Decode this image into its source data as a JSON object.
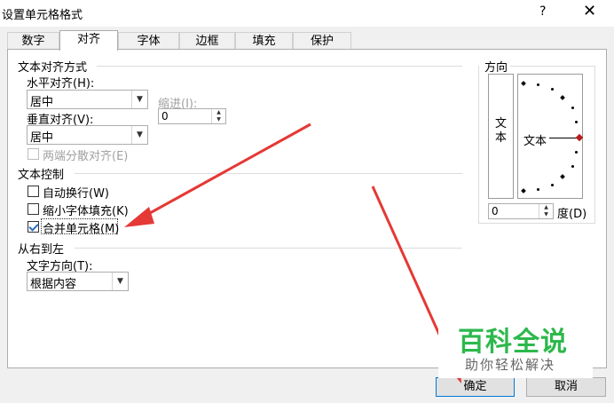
{
  "window": {
    "title": "设置单元格格式",
    "help": "?",
    "close": "✕"
  },
  "tabs": [
    {
      "label": "数字"
    },
    {
      "label": "对齐"
    },
    {
      "label": "字体"
    },
    {
      "label": "边框"
    },
    {
      "label": "填充"
    },
    {
      "label": "保护"
    }
  ],
  "alignment": {
    "group_title": "文本对齐方式",
    "horizontal_label": "水平对齐(H):",
    "horizontal_value": "居中",
    "vertical_label": "垂直对齐(V):",
    "vertical_value": "居中",
    "indent_label": "缩进(I):",
    "indent_value": "0",
    "justify_distributed_label": "两端分散对齐(E)"
  },
  "text_control": {
    "group_title": "文本控制",
    "wrap_label": "自动换行(W)",
    "wrap_checked": false,
    "shrink_label": "缩小字体填充(K)",
    "shrink_checked": false,
    "merge_label": "合并单元格(M)",
    "merge_checked": true
  },
  "rtl": {
    "group_title": "从右到左",
    "direction_label": "文字方向(T):",
    "direction_value": "根据内容"
  },
  "orientation": {
    "group_title": "方向",
    "vertical_text": "文本",
    "text": "文本",
    "degrees_value": "0",
    "degrees_label": "度(D)"
  },
  "buttons": {
    "ok": "确定",
    "cancel": "取消"
  },
  "watermark": {
    "main": "百科全说",
    "sub": "助你轻松解决"
  },
  "colors": {
    "arrow": "#e53935",
    "watermark_green": "#2db84c",
    "accent": "#0078d7"
  }
}
